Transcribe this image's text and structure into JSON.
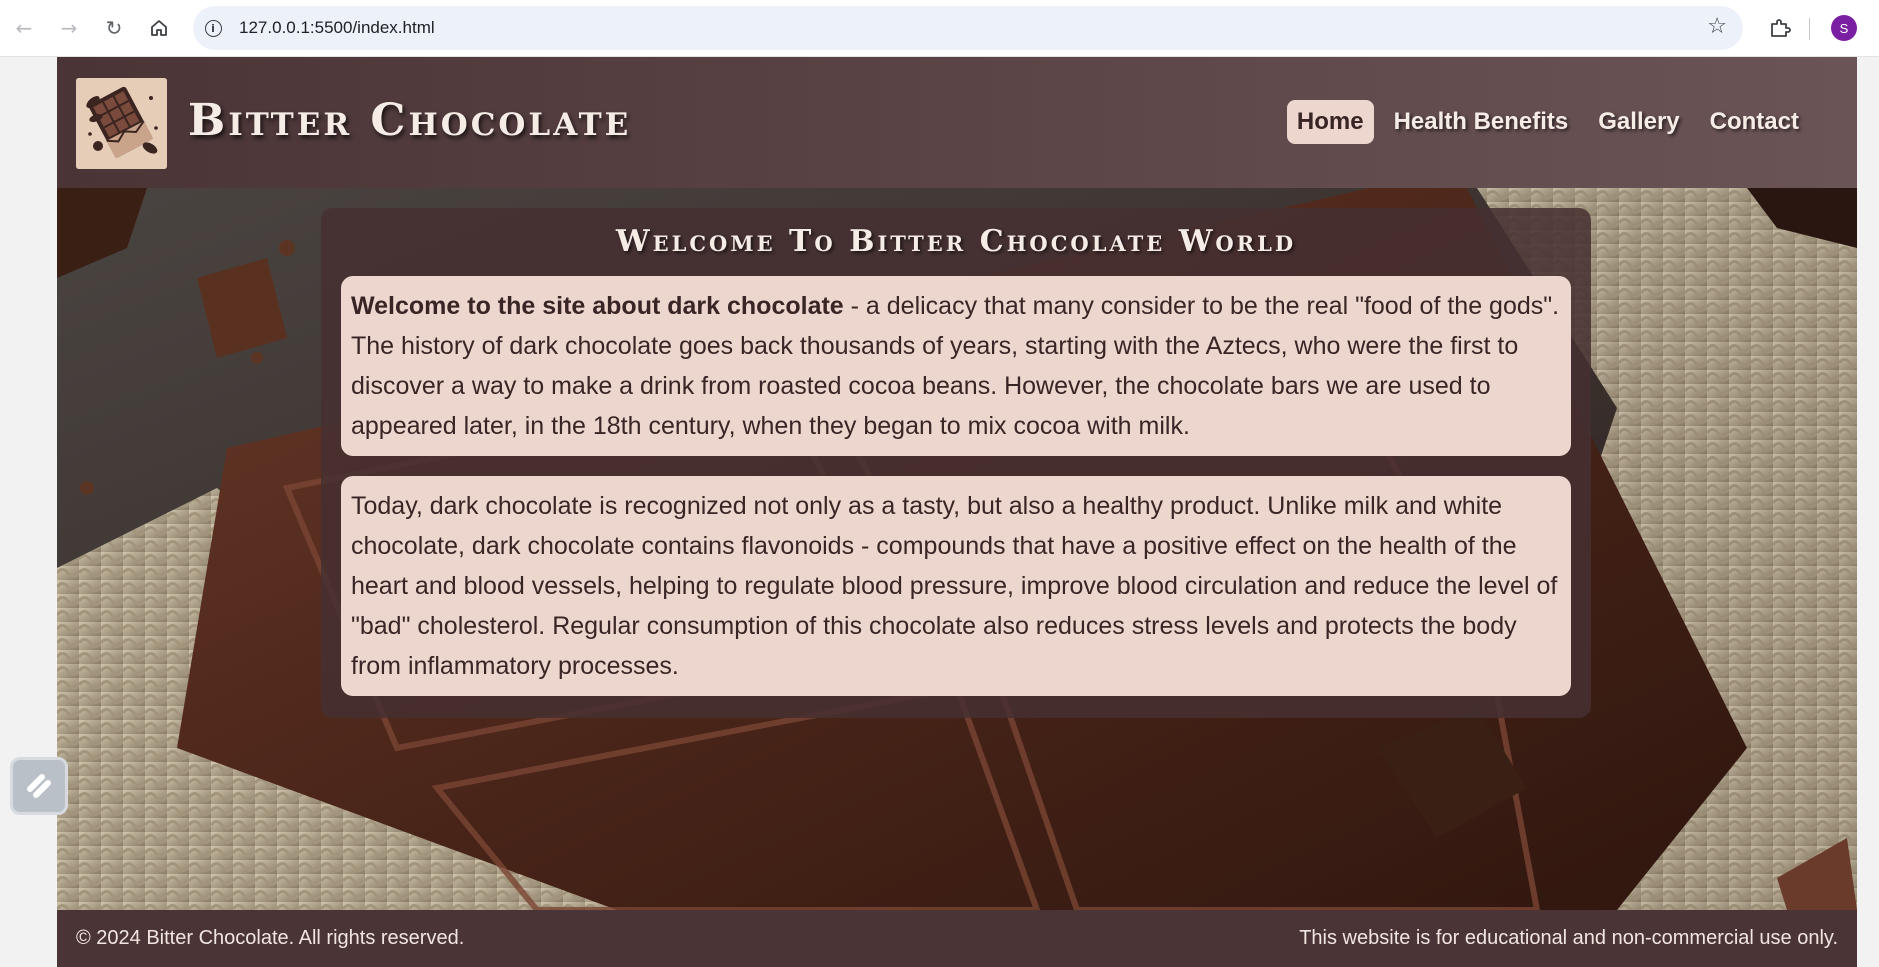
{
  "browser": {
    "url": "127.0.0.1:5500/index.html",
    "back_icon": "arrow-left-icon",
    "forward_icon": "arrow-right-icon",
    "reload_icon": "reload-icon",
    "home_icon": "home-icon",
    "site_info_icon": "info-icon",
    "bookmark_icon": "star-icon",
    "extensions_icon": "puzzle-icon",
    "profile_initial": "S",
    "profile_color": "#7b1fa2"
  },
  "header": {
    "brand": "Bitter Chocolate",
    "nav": [
      {
        "label": "Home",
        "active": true
      },
      {
        "label": "Health Benefits",
        "active": false
      },
      {
        "label": "Gallery",
        "active": false
      },
      {
        "label": "Contact",
        "active": false
      }
    ]
  },
  "main": {
    "title": "Welcome To Bitter Chocolate World",
    "card1": {
      "lead": "Welcome to the site about dark chocolate",
      "text": " - a delicacy that many consider to be the real \"food of the gods\". The history of dark chocolate goes back thousands of years, starting with the Aztecs, who were the first to discover a way to make a drink from roasted cocoa beans. However, the chocolate bars we are used to appeared later, in the 18th century, when they began to mix cocoa with milk."
    },
    "card2": {
      "text": "Today, dark chocolate is recognized not only as a tasty, but also a healthy product. Unlike milk and white chocolate, dark chocolate contains flavonoids - compounds that have a positive effect on the health of the heart and blood vessels, helping to regulate blood pressure, improve blood circulation and reduce the level of \"bad\" cholesterol. Regular consumption of this chocolate also reduces stress levels and protects the body from inflammatory processes."
    }
  },
  "footer": {
    "copyright": "© 2024 Bitter Chocolate. All rights reserved.",
    "disclaimer": "This website is for educational and non-commercial use only."
  },
  "colors": {
    "header_bg": "#5a4445",
    "footer_bg": "#4a3435",
    "card_bg": "#ecd6cd",
    "text_dark": "#3a2526",
    "text_light": "#f6ece6"
  }
}
